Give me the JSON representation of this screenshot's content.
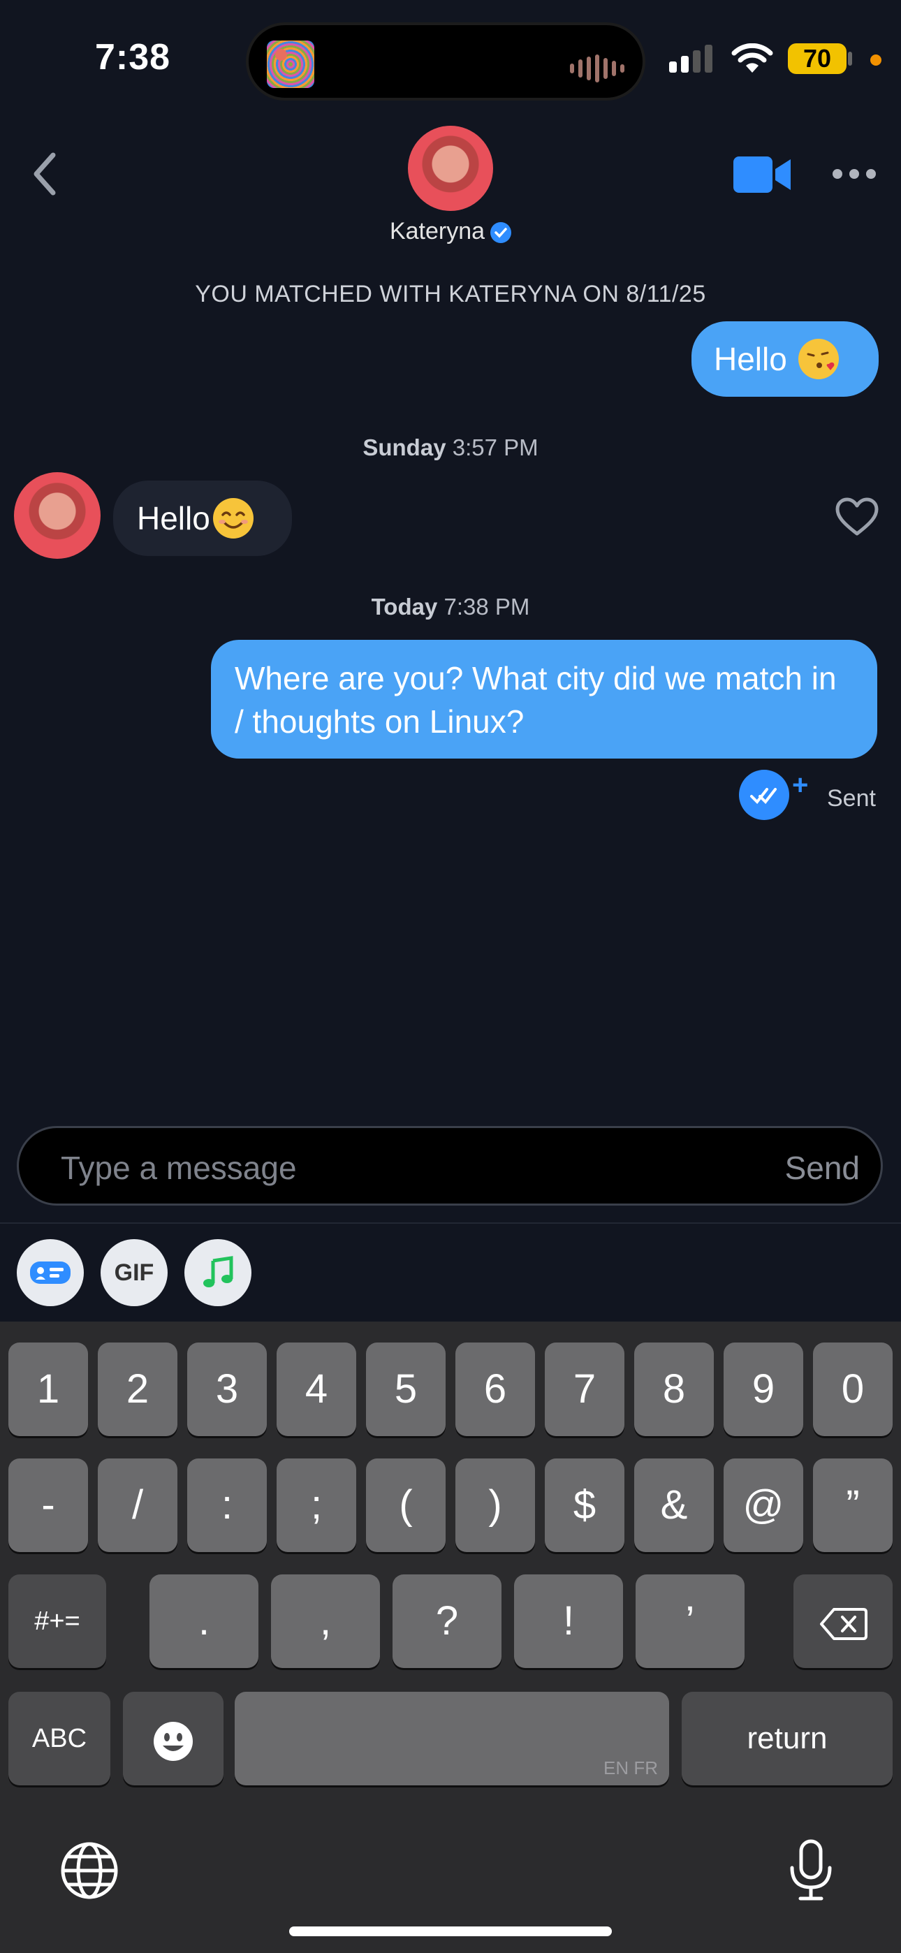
{
  "status_bar": {
    "time": "7:38",
    "battery": "70"
  },
  "header": {
    "contact_name": "Kateryna"
  },
  "chat": {
    "matched_banner": "YOU MATCHED WITH KATERYNA ON 8/11/25",
    "messages": [
      {
        "direction": "outgoing",
        "text": "Hello"
      },
      {
        "direction": "incoming",
        "text": "Hello"
      },
      {
        "direction": "outgoing",
        "text": "Where are you? What city did we match in / thoughts on Linux?"
      }
    ],
    "timestamps": [
      {
        "day": "Sunday",
        "time": "3:57 PM"
      },
      {
        "day": "Today",
        "time": "7:38 PM"
      }
    ],
    "status": "Sent"
  },
  "composer": {
    "placeholder": "Type a message",
    "send_label": "Send"
  },
  "quick_actions": {
    "gif_label": "GIF"
  },
  "keyboard": {
    "row1": [
      "1",
      "2",
      "3",
      "4",
      "5",
      "6",
      "7",
      "8",
      "9",
      "0"
    ],
    "row2": [
      "-",
      "/",
      ":",
      ";",
      "(",
      ")",
      "$",
      "&",
      "@",
      "”"
    ],
    "row3": [
      ".",
      ",",
      "?",
      "!",
      "’"
    ],
    "symbols_key": "#+=",
    "abc_key": "ABC",
    "return_key": "return",
    "space_lang": "EN FR"
  },
  "colors": {
    "background": "#111520",
    "outgoing_bubble": "#4aa3f6",
    "incoming_bubble": "#1e2330",
    "accent": "#2f8dff"
  }
}
